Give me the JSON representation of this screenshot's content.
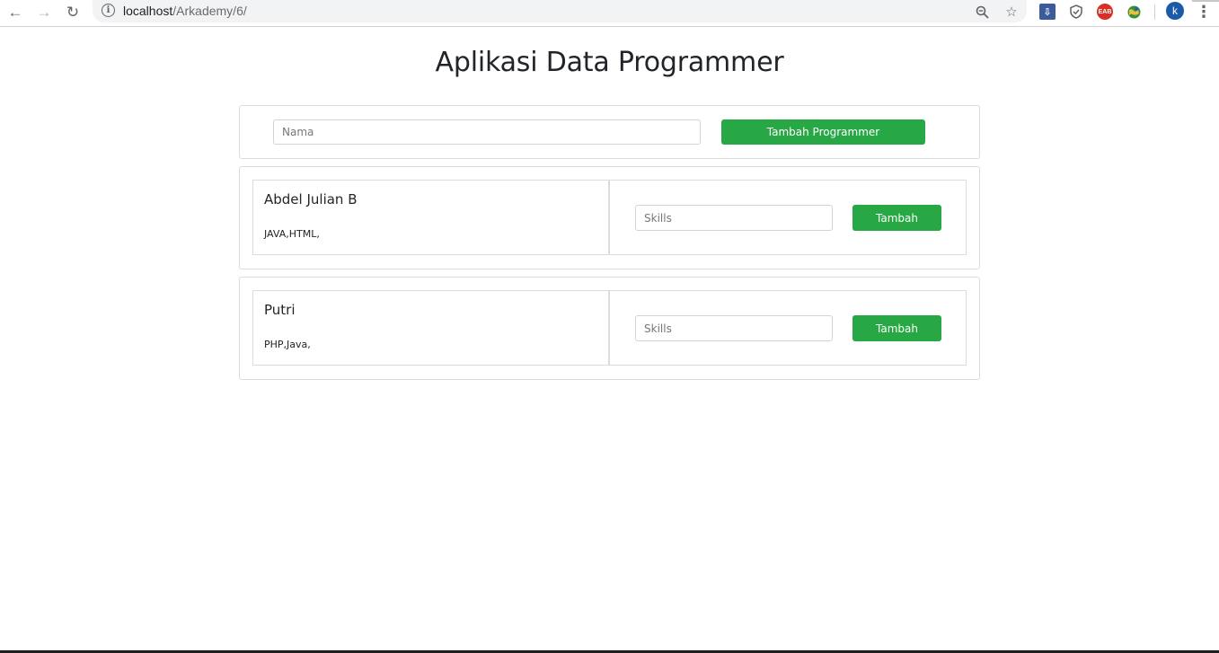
{
  "browser": {
    "url_host": "localhost",
    "url_path": "/Arkademy/6/",
    "avatar_letter": "k",
    "extensions": {
      "eab_label": "EAB"
    }
  },
  "page": {
    "title": "Aplikasi Data Programmer"
  },
  "add_form": {
    "name_placeholder": "Nama",
    "add_button_label": "Tambah Programmer"
  },
  "programmers": [
    {
      "name": "Abdel Julian B",
      "skills": "JAVA,HTML,",
      "skill_placeholder": "Skills",
      "add_skill_label": "Tambah"
    },
    {
      "name": "Putri",
      "skills": "PHP,Java,",
      "skill_placeholder": "Skills",
      "add_skill_label": "Tambah"
    }
  ],
  "colors": {
    "accent_green": "#28a745",
    "border": "#dcdcdc"
  }
}
